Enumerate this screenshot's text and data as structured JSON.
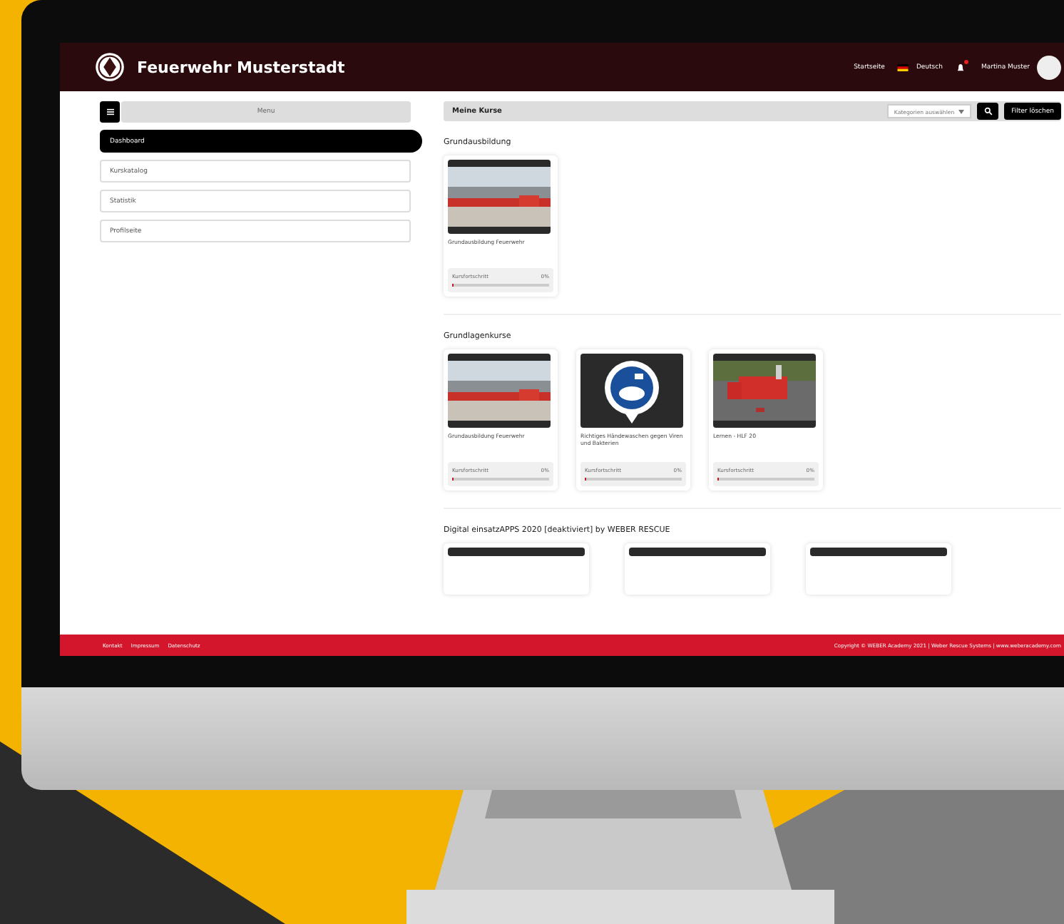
{
  "header": {
    "title": "Feuerwehr Musterstadt",
    "links": [
      "Startseite",
      "Deutsch"
    ],
    "notification": true,
    "user": "Martina Muster"
  },
  "sidebar": {
    "menu_label": "Menu",
    "items": [
      {
        "label": "Dashboard",
        "selected": true
      },
      {
        "label": "Kurskatalog",
        "selected": false
      },
      {
        "label": "Statistik",
        "selected": false
      },
      {
        "label": "Profilseite",
        "selected": false
      }
    ]
  },
  "toolbar": {
    "title": "Meine Kurse",
    "category_select": "Kategorien auswählen",
    "filter_button": "Filter löschen"
  },
  "sections": [
    {
      "title": "Grundausbildung",
      "courses": [
        {
          "kind": "trucks",
          "title": "Grundausbildung Feuerwehr",
          "progress_label": "Kursfortschritt",
          "percent": "0%",
          "level": 0
        }
      ]
    },
    {
      "title": "Grundlagenkurse",
      "courses": [
        {
          "kind": "trucks",
          "title": "Grundausbildung Feuerwehr",
          "progress_label": "Kursfortschritt",
          "percent": "0%",
          "level": 0
        },
        {
          "kind": "sign",
          "title": "Richtiges Händewaschen gegen Viren und Bakterien",
          "progress_label": "Kursfortschritt",
          "percent": "0%",
          "level": 0
        },
        {
          "kind": "vehicle",
          "title": "Lernen - HLF 20",
          "progress_label": "Kursfortschritt",
          "percent": "0%",
          "level": 0
        }
      ]
    },
    {
      "title": "Digital einsatzAPPS 2020 [deaktiviert] by WEBER RESCUE",
      "courses": [
        {
          "kind": "cut"
        },
        {
          "kind": "cut"
        },
        {
          "kind": "cut"
        }
      ]
    }
  ],
  "footer": {
    "links": [
      "Kontakt",
      "Impressum",
      "Datenschutz"
    ],
    "copyright": "Copyright © WEBER Academy 2021 | Weber Rescue Systems | www.weberacademy.com"
  }
}
